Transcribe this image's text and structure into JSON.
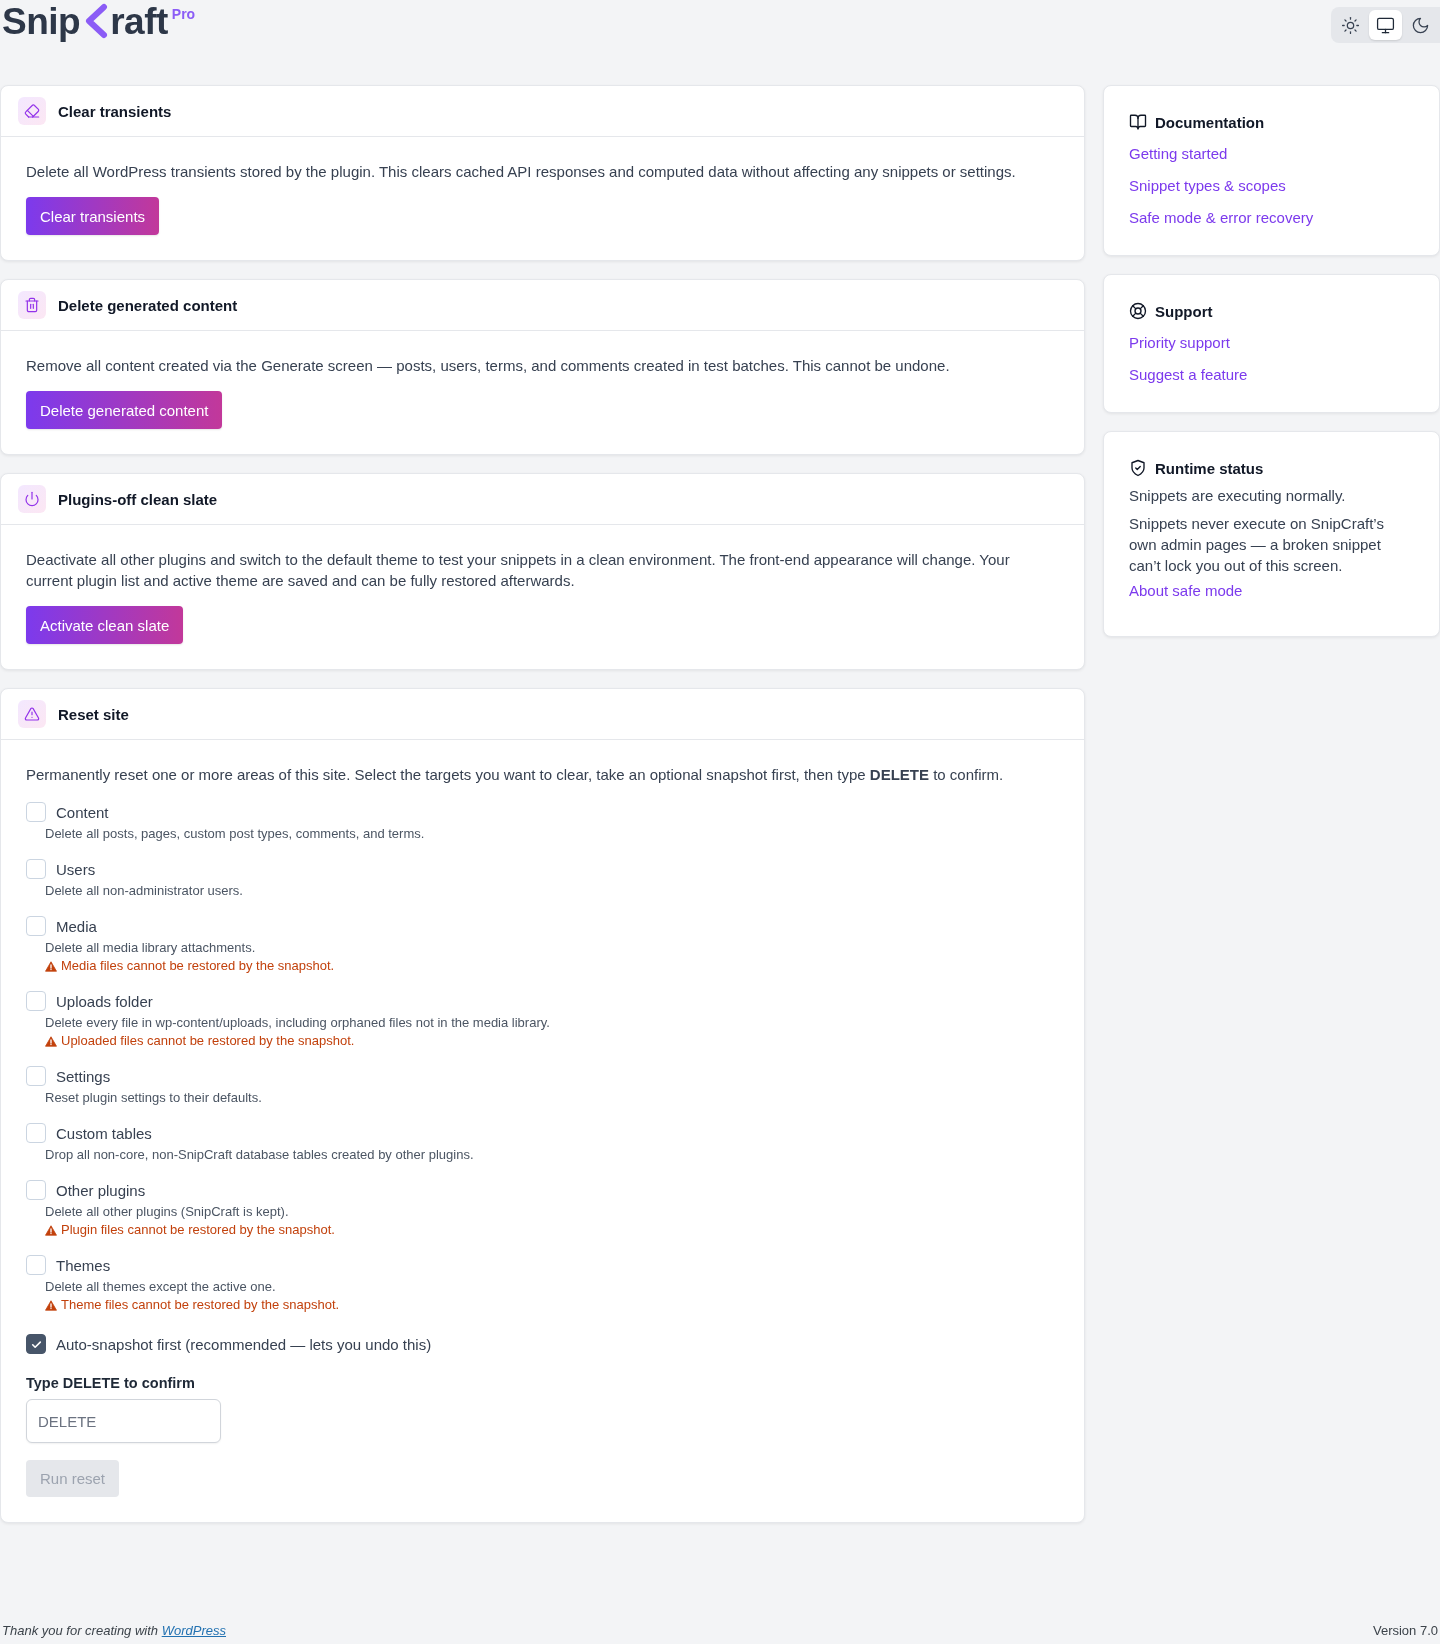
{
  "header": {
    "logo": {
      "text_start": "Snip",
      "text_end": "raft",
      "badge": "Pro"
    },
    "theme_toggle": [
      {
        "kind": "light",
        "selected": false
      },
      {
        "kind": "system",
        "selected": true
      },
      {
        "kind": "dark",
        "selected": false
      }
    ]
  },
  "main_cards": [
    {
      "kind": "clear",
      "title": "Clear transients",
      "description": "Delete all WordPress transients stored by the plugin. This clears cached API responses and computed data without affecting any snippets or settings.",
      "button": {
        "label": "Clear transients",
        "disabled": false
      }
    },
    {
      "kind": "delete",
      "title": "Delete generated content",
      "description": "Remove all content created via the Generate screen — posts, users, terms, and comments created in test batches. This cannot be undone.",
      "button": {
        "label": "Delete generated content",
        "disabled": false
      }
    },
    {
      "kind": "power",
      "title": "Plugins-off clean slate",
      "description": "Deactivate all other plugins and switch to the default theme to test your snippets in a clean environment. The front-end appearance will change. Your current plugin list and active theme are saved and can be fully restored afterwards.",
      "button": {
        "label": "Activate clean slate",
        "disabled": false
      }
    },
    {
      "kind": "reset",
      "title": "Reset site",
      "description": "Permanently reset one or more areas of this site. Select the targets you want to clear, take an optional snapshot first, then type **DELETE** to confirm.",
      "targets": [
        {
          "label": "Content",
          "description": "Delete all posts, pages, custom post types, comments, and terms.",
          "checked": false
        },
        {
          "label": "Users",
          "description": "Delete all non-administrator users.",
          "checked": false
        },
        {
          "label": "Media",
          "description": "Delete all media library attachments.",
          "warning": "Media files cannot be restored by the snapshot.",
          "checked": false
        },
        {
          "label": "Uploads folder",
          "description": "Delete every file in wp-content/uploads, including orphaned files not in the media library.",
          "warning": "Uploaded files cannot be restored by the snapshot.",
          "checked": false
        },
        {
          "label": "Settings",
          "description": "Reset plugin settings to their defaults.",
          "checked": false
        },
        {
          "label": "Custom tables",
          "description": "Drop all non-core, non-SnipCraft database tables created by other plugins.",
          "checked": false
        },
        {
          "label": "Other plugins",
          "description": "Delete all other plugins (SnipCraft is kept).",
          "warning": "Plugin files cannot be restored by the snapshot.",
          "checked": false
        },
        {
          "label": "Themes",
          "description": "Delete all themes except the active one.",
          "warning": "Theme files cannot be restored by the snapshot.",
          "checked": false
        }
      ],
      "auto_snapshot": {
        "label": "Auto-snapshot first (recommended — lets you undo this)",
        "checked": true
      },
      "confirm": {
        "label": "Type DELETE to confirm",
        "placeholder": "DELETE"
      },
      "button": {
        "label": "Run reset",
        "disabled": true
      }
    }
  ],
  "sidebar": [
    {
      "kind": "docs",
      "title": "Documentation",
      "links": [
        "Getting started",
        "Snippet types & scopes",
        "Safe mode & error recovery"
      ]
    },
    {
      "kind": "support",
      "title": "Support",
      "links": [
        "Priority support",
        "Suggest a feature"
      ]
    },
    {
      "kind": "status",
      "title": "Runtime status",
      "status": "Snippets are executing normally.",
      "note": "Snippets never execute on SnipCraft’s own admin pages — a broken snippet can’t lock you out of this screen.",
      "links": [
        "About safe mode"
      ]
    }
  ],
  "footer": {
    "thanks": "Thank you for creating with",
    "link": "WordPress",
    "version": "Version 7.0"
  }
}
